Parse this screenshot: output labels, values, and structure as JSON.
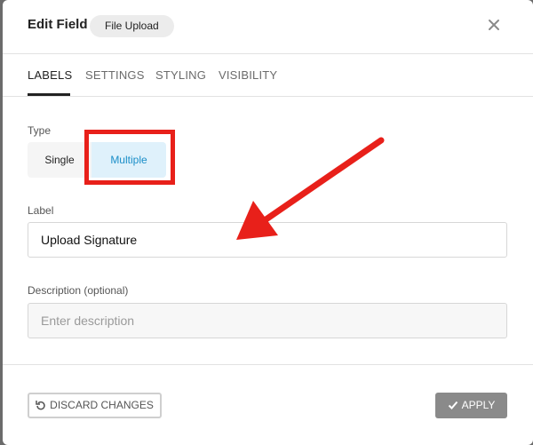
{
  "dialog": {
    "title": "Edit Field",
    "field_type_pill": "File Upload",
    "close_icon": "close-icon"
  },
  "tabs": [
    {
      "label": "LABELS",
      "active": true
    },
    {
      "label": "SETTINGS",
      "active": false
    },
    {
      "label": "STYLING",
      "active": false
    },
    {
      "label": "VISIBILITY",
      "active": false
    }
  ],
  "type_section": {
    "label": "Type",
    "options": [
      "Single",
      "Multiple"
    ],
    "selected": "Multiple"
  },
  "label_section": {
    "label": "Label",
    "value": "Upload Signature"
  },
  "description_section": {
    "label": "Description (optional)",
    "placeholder": "Enter description",
    "value": ""
  },
  "footer": {
    "discard_label": "DISCARD CHANGES",
    "discard_icon": "undo-icon",
    "apply_label": "APPLY",
    "apply_icon": "check-icon"
  },
  "colors": {
    "accent": "#1a8ec8",
    "selected_bg": "#dff1fb",
    "annotation_red": "#e8201a",
    "apply_bg": "#8a8a8a"
  }
}
